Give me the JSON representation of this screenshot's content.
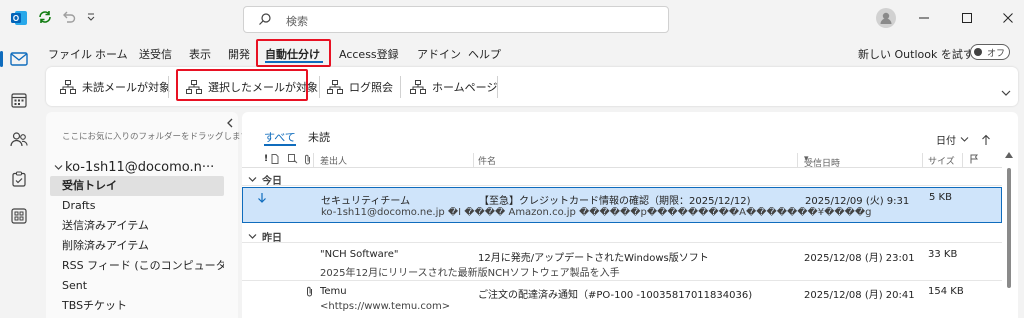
{
  "search": {
    "placeholder": "検索"
  },
  "menu": {
    "tabs": [
      "ファイル",
      "ホーム",
      "送受信",
      "表示",
      "開発",
      "自動仕分け",
      "Access登録",
      "アドイン",
      "ヘルプ"
    ],
    "try_new": "新しい Outlook を試す",
    "toggle_label": "オフ"
  },
  "ribbon": {
    "buttons": [
      "未読メールが対象",
      "選択したメールが対象",
      "ログ照会",
      "ホームページ"
    ]
  },
  "folders": {
    "favorites_hint": "ここにお気に入りのフォルダーをドラッグします",
    "account": "ko-1sh11@docomo.n···",
    "items": [
      "受信トレイ",
      "Drafts",
      "送信済みアイテム",
      "削除済みアイテム",
      "RSS フィード (このコンピューター...",
      "Sent",
      "TBSチケット"
    ]
  },
  "list": {
    "tab_all": "すべて",
    "tab_unread": "未読",
    "sort_label": "日付",
    "columns": {
      "from": "差出人",
      "subject": "件名",
      "received": "受信日時",
      "size": "サイズ"
    },
    "groups": {
      "today": "今日",
      "yesterday": "昨日"
    },
    "messages": [
      {
        "from": "セキュリティチーム",
        "subject": "【至急】クレジットカード情報の確認（期限：2025/12/12)",
        "received": "2025/12/09 (火) 9:31",
        "size": "5 KB",
        "preview": "ko-1sh11@docomo.ne.jp �I ���� Amazon.co.jp ������p���������A�������¥����g"
      },
      {
        "from": "\"NCH Software\"",
        "subject": "12月に発売/アップデートされたWindows版ソフト",
        "received": "2025/12/08 (月) 23:01",
        "size": "33 KB",
        "preview": "2025年12月にリリースされた最新版NCHソフトウェア製品を入手"
      },
      {
        "from": "Temu",
        "subject": "ご注文の配達済み通知（#PO-100 -10035817011834036)",
        "received": "2025/12/08 (月) 20:41",
        "size": "154 KB",
        "preview": "<https://www.temu.com>"
      }
    ]
  },
  "colors": {
    "accent": "#0f6cbd",
    "highlight_box": "#e81123",
    "selected_row": "#cfe4fa"
  }
}
